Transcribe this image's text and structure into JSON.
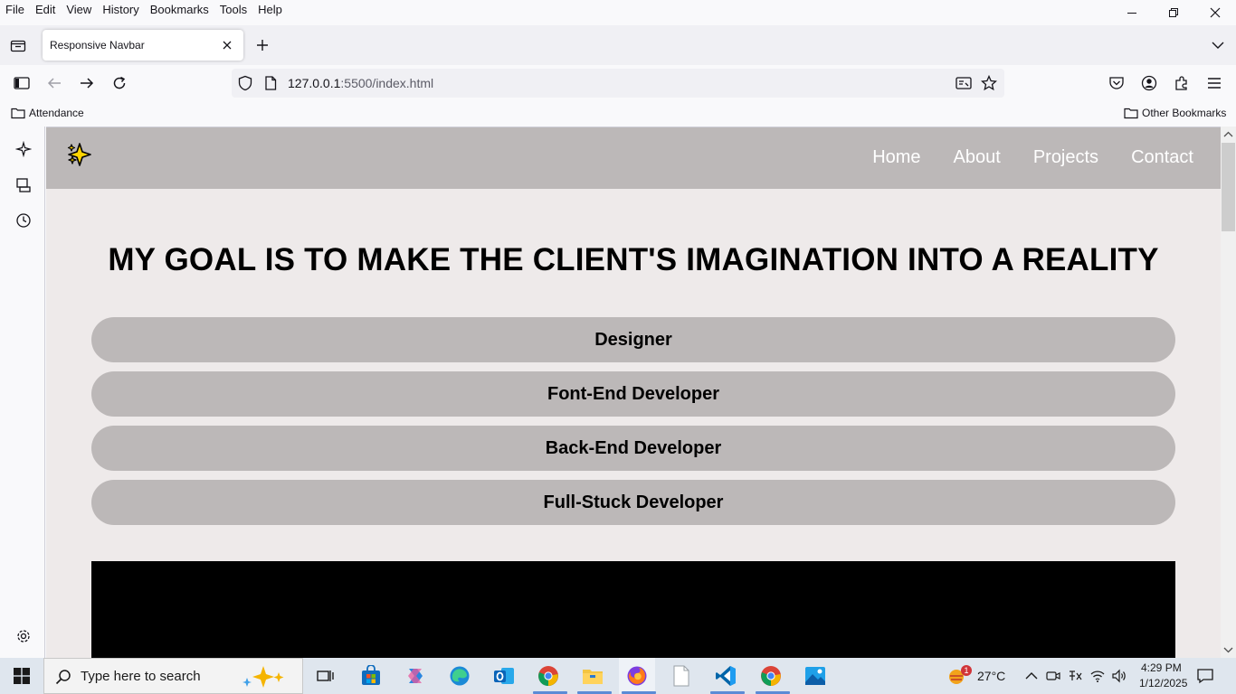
{
  "menu": [
    "File",
    "Edit",
    "View",
    "History",
    "Bookmarks",
    "Tools",
    "Help"
  ],
  "tab": {
    "title": "Responsive Navbar"
  },
  "url": {
    "host": "127.0.0.1",
    "rest": ":5500/index.html"
  },
  "bookmarks": {
    "left": "Attendance",
    "right": "Other Bookmarks"
  },
  "site": {
    "nav_links": [
      "Home",
      "About",
      "Projects",
      "Contact"
    ],
    "hero_title": "MY GOAL IS TO MAKE THE CLIENT'S IMAGINATION INTO A REALITY",
    "roles": [
      "Designer",
      "Font-End Developer",
      "Back-End Developer",
      "Full-Stuck Developer"
    ],
    "logo_glyph": "✨"
  },
  "taskbar": {
    "search_placeholder": "Type here to search",
    "weather": "27°C",
    "weather_badge": "1",
    "time": "4:29 PM",
    "date": "1/12/2025"
  },
  "colors": {
    "site_nav_bg": "#bcb8b8",
    "content_bg": "#eeeaea",
    "pill_bg": "#bcb8b8"
  }
}
